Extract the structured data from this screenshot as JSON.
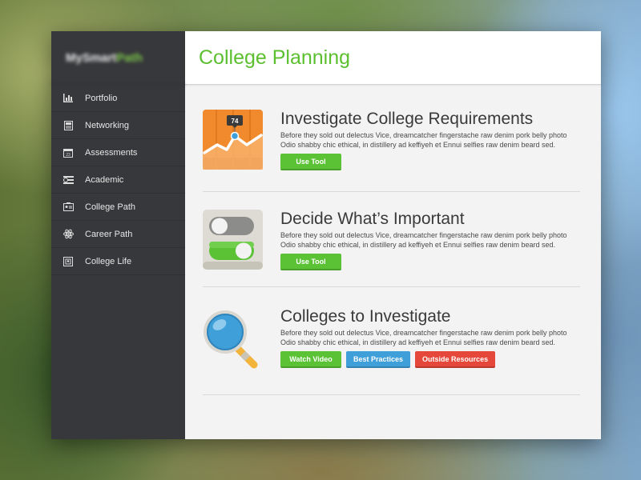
{
  "app": {
    "logo_part1": "MySmart",
    "logo_part2": "Path"
  },
  "sidebar": {
    "items": [
      {
        "label": "Portfolio",
        "icon": "bar-chart-icon"
      },
      {
        "label": "Networking",
        "icon": "notebook-icon"
      },
      {
        "label": "Assessments",
        "icon": "calendar-icon"
      },
      {
        "label": "Academic",
        "icon": "money-icon"
      },
      {
        "label": "College Path",
        "icon": "id-card-icon"
      },
      {
        "label": "Career Path",
        "icon": "atom-icon"
      },
      {
        "label": "College Life",
        "icon": "frame-icon"
      }
    ]
  },
  "header": {
    "title": "College Planning"
  },
  "sections": [
    {
      "title": "Investigate College Requirements",
      "line1": "Before they sold out delectus Vice, dreamcatcher fingerstache raw denim pork belly photo",
      "line2": "Odio shabby chic ethical, in distillery ad keffiyeh et Ennui selfies raw denim beard sed.",
      "chart_badge": "74",
      "buttons": [
        "Use Tool"
      ],
      "icon": "line-chart-icon"
    },
    {
      "title": "Decide What’s Important",
      "line1": "Before they sold out delectus Vice, dreamcatcher fingerstache raw denim pork belly photo",
      "line2": "Odio shabby chic ethical, in distillery ad keffiyeh et Ennui selfies raw denim beard sed.",
      "buttons": [
        "Use Tool"
      ],
      "icon": "toggle-switches-icon"
    },
    {
      "title": "Colleges to Investigate",
      "line1": "Before they sold out delectus Vice, dreamcatcher fingerstache raw denim pork belly photo",
      "line2": "Odio shabby chic ethical, in distillery ad keffiyeh et Ennui selfies raw denim beard sed.",
      "buttons": [
        "Watch Video",
        "Best Practices",
        "Outside Resources"
      ],
      "icon": "magnifier-icon"
    }
  ],
  "colors": {
    "accent_green": "#5cbf30",
    "button_green": "#5bc236",
    "button_blue": "#3f9fd8",
    "button_red": "#e5473a",
    "sidebar_bg": "#37383b"
  }
}
